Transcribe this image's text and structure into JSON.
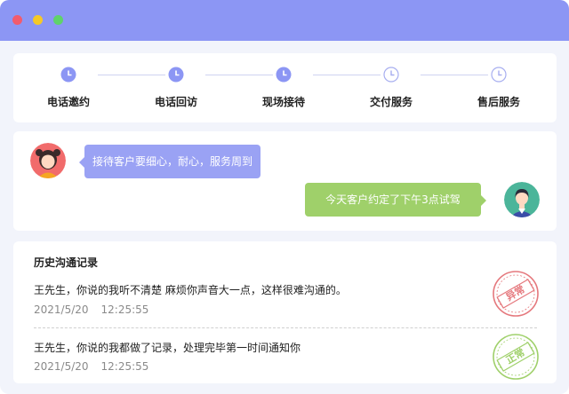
{
  "window": {
    "controls": [
      "close",
      "minimize",
      "maximize"
    ],
    "colors": {
      "titlebar": "#8c96f4",
      "close": "#f25b6d",
      "minimize": "#f5c928",
      "maximize": "#5fd36a"
    }
  },
  "steps": {
    "items": [
      {
        "label": "电话邀约",
        "status": "done"
      },
      {
        "label": "电话回访",
        "status": "done"
      },
      {
        "label": "现场接待",
        "status": "done"
      },
      {
        "label": "交付服务",
        "status": "pending"
      },
      {
        "label": "售后服务",
        "status": "pending"
      }
    ],
    "colors": {
      "done": "#8c96f4",
      "pending": "#a7aef0"
    }
  },
  "chat": {
    "messages": [
      {
        "side": "left",
        "text": "接待客户要细心，耐心，服务周到",
        "color": "#9aa2f4"
      },
      {
        "side": "right",
        "text": "今天客户约定了下午3点试驾",
        "color": "#9fd06a"
      }
    ]
  },
  "history": {
    "title": "历史沟通记录",
    "records": [
      {
        "text": "王先生，你说的我听不清楚 麻烦你声音大一点，这样很难沟通的。",
        "date": "2021/5/20",
        "time": "12:25:55",
        "stamp": "异常",
        "stamp_color": "#e5787d"
      },
      {
        "text": "王先生，你说的我都做了记录，处理完毕第一时间通知你",
        "date": "2021/5/20",
        "time": "12:25:55",
        "stamp": "正常",
        "stamp_color": "#9fd06a"
      }
    ]
  }
}
